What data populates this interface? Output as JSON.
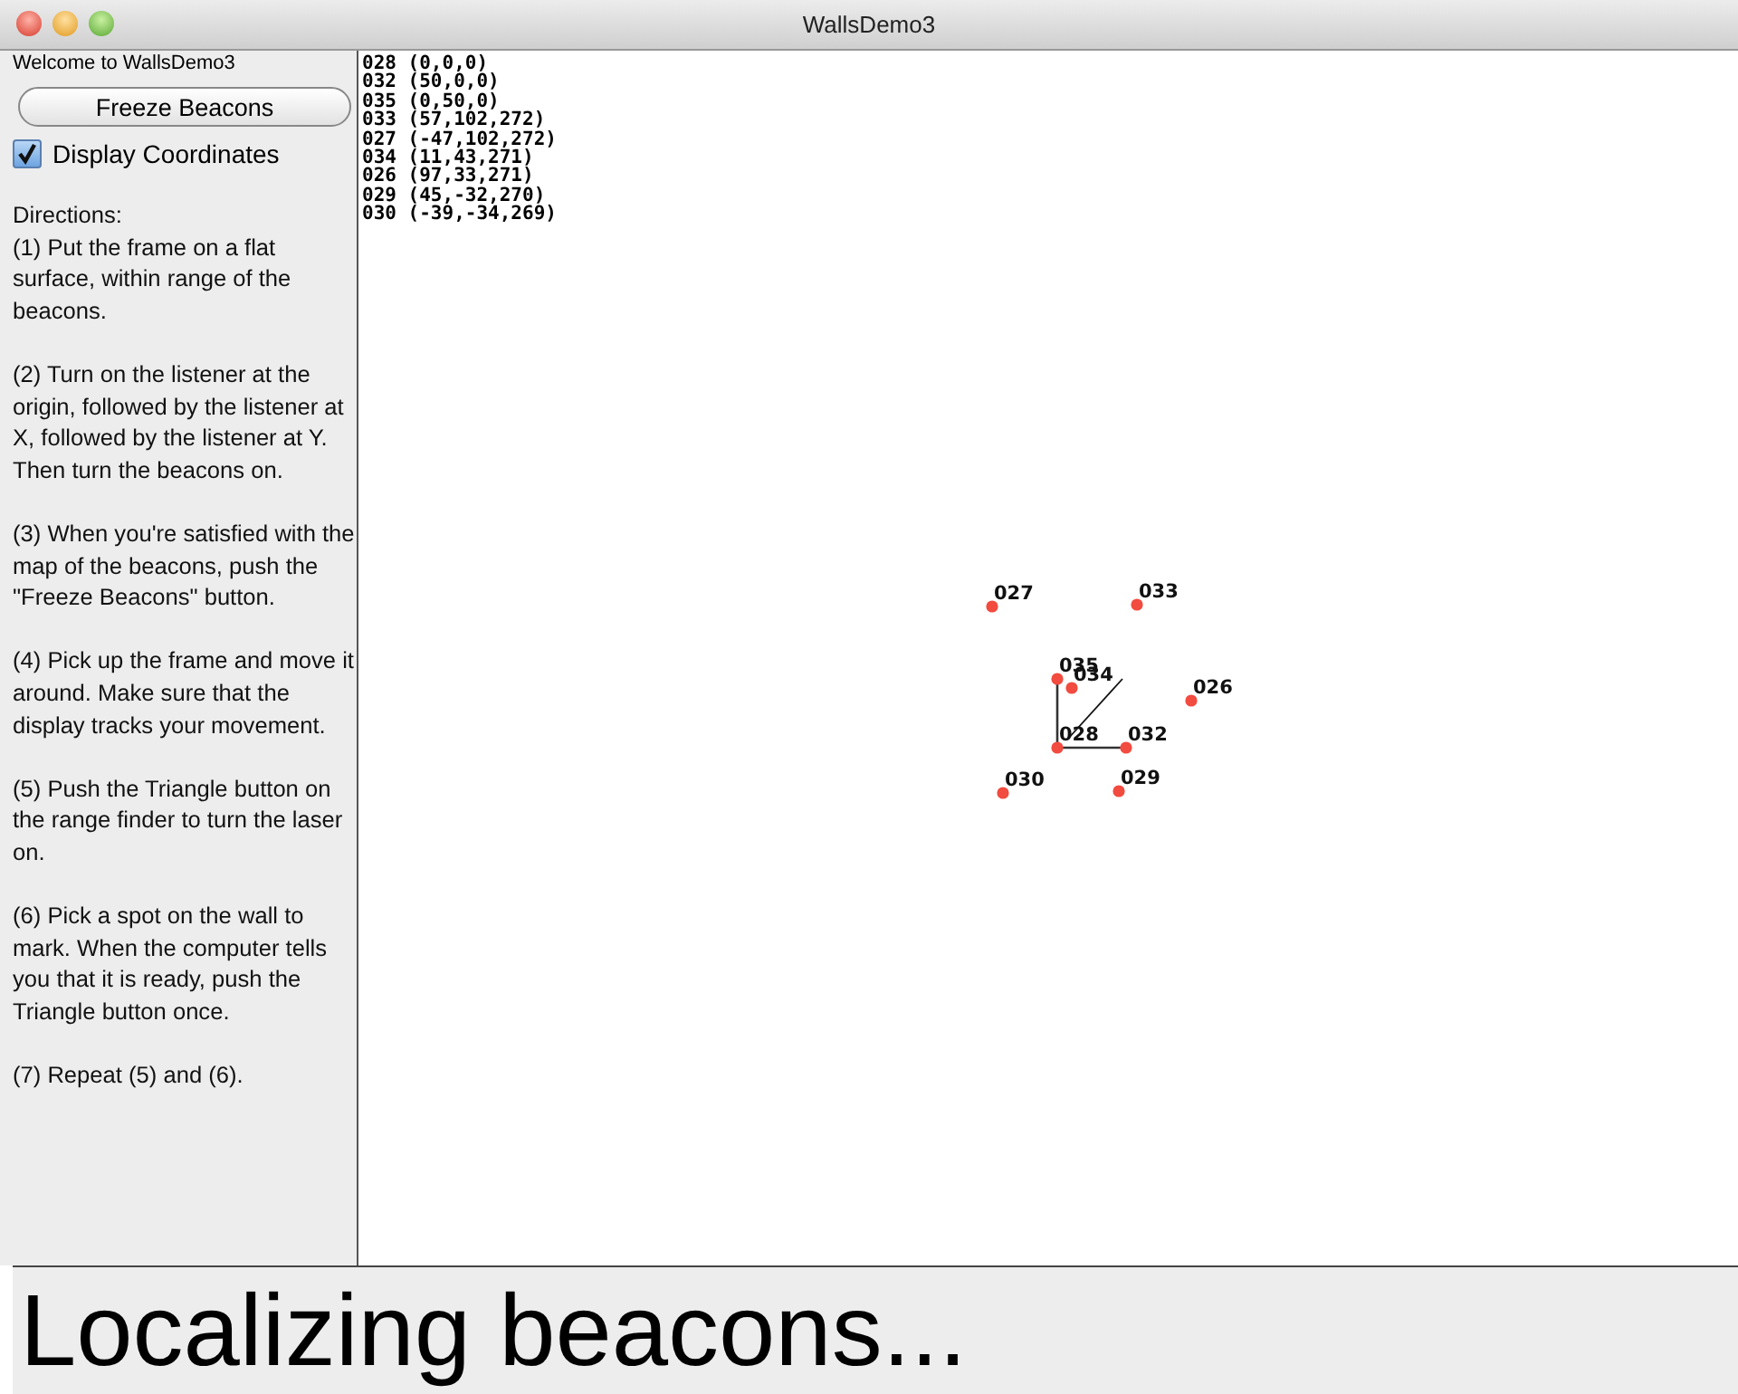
{
  "window": {
    "title": "WallsDemo3"
  },
  "sidebar": {
    "welcome": "Welcome to WallsDemo3",
    "freeze_button": "Freeze Beacons",
    "display_coordinates": {
      "label": "Display Coordinates",
      "checked": true
    },
    "directions": [
      "Directions:\n(1) Put the frame on a flat surface, within range of the beacons.",
      "(2) Turn on the listener at the origin, followed by the listener at X, followed by the listener at Y. Then turn the beacons on.",
      "(3) When you're satisfied with the map of the beacons, push the \"Freeze Beacons\" button.",
      "(4) Pick up the frame and move it around. Make sure that the display tracks your movement.",
      "(5) Push the Triangle button on the range finder to turn the laser on.",
      "(6) Pick a spot on the wall to mark. When the computer tells you that it is ready, push the Triangle button once.",
      "(7) Repeat (5) and (6)."
    ]
  },
  "coordinates": [
    "028 (0,0,0)",
    "032 (50,0,0)",
    "035 (0,50,0)",
    "033 (57,102,272)",
    "027 (-47,102,272)",
    "034 (11,43,271)",
    "026 (97,33,271)",
    "029 (45,-32,270)",
    "030 (-39,-34,269)"
  ],
  "beacons": [
    "028",
    "032",
    "035",
    "033",
    "027",
    "034",
    "026",
    "029",
    "030"
  ],
  "status": "Localizing beacons..."
}
